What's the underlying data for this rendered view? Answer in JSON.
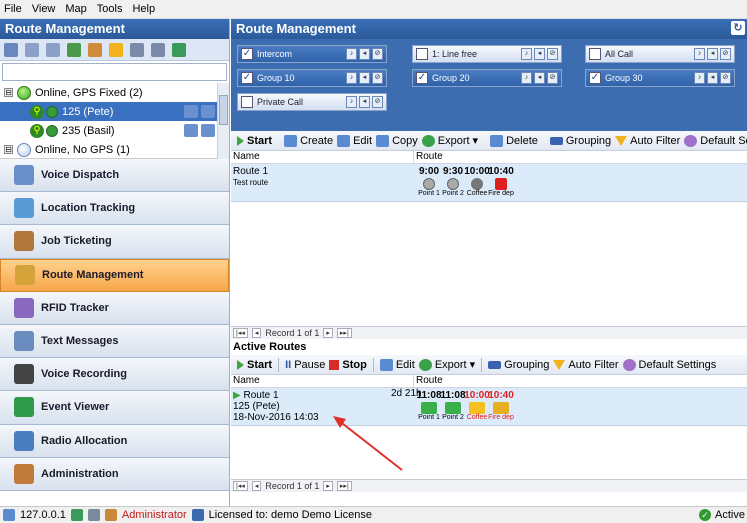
{
  "menu": [
    "File",
    "View",
    "Map",
    "Tools",
    "Help"
  ],
  "left_panel": {
    "title": "Route Management",
    "tree": [
      {
        "label": "Online, GPS Fixed (2)",
        "status": "green",
        "expand": "⊟"
      },
      {
        "label": "125 (Pete)",
        "selected": true
      },
      {
        "label": "235 (Basil)"
      },
      {
        "label": "Online, No GPS (1)",
        "status": "blue",
        "expand": "⊟"
      }
    ],
    "nav_items": [
      {
        "label": "Voice Dispatch",
        "icon": "voice-dispatch-icon",
        "color": "#6b8fc9"
      },
      {
        "label": "Location Tracking",
        "icon": "location-tracking-icon",
        "color": "#5a9bd5"
      },
      {
        "label": "Job Ticketing",
        "icon": "job-ticketing-icon",
        "color": "#b0783a"
      },
      {
        "label": "Route Management",
        "icon": "route-management-icon",
        "color": "#d4a43a",
        "active": true
      },
      {
        "label": "RFID Tracker",
        "icon": "rfid-tracker-icon",
        "color": "#8a6ac0"
      },
      {
        "label": "Text Messages",
        "icon": "text-messages-icon",
        "color": "#6a8cbf"
      },
      {
        "label": "Voice Recording",
        "icon": "voice-recording-icon",
        "color": "#444"
      },
      {
        "label": "Event Viewer",
        "icon": "event-viewer-icon",
        "color": "#2e9a4a"
      },
      {
        "label": "Radio Allocation",
        "icon": "radio-allocation-icon",
        "color": "#4a7cc0"
      },
      {
        "label": "Administration",
        "icon": "administration-icon",
        "color": "#c07a3a"
      }
    ]
  },
  "right_panel": {
    "title": "Route Management",
    "groups": [
      {
        "label": "Intercom",
        "checked": true
      },
      {
        "label": "1: Line free",
        "checked": false
      },
      {
        "label": "All Call",
        "checked": true
      },
      {
        "label": "Group 10",
        "checked": true
      },
      {
        "label": "Group 20",
        "checked": true
      },
      {
        "label": "Group 30",
        "checked": true
      },
      {
        "label": "Private Call",
        "checked": false
      }
    ],
    "routes_toolbar": {
      "start": "Start",
      "create": "Create",
      "edit": "Edit",
      "copy": "Copy",
      "export": "Export",
      "delete": "Delete",
      "grouping": "Grouping",
      "auto_filter": "Auto Filter",
      "default_settings": "Default Settings"
    },
    "grid_headers": {
      "name": "Name",
      "route": "Route"
    },
    "routes": [
      {
        "name": "Route 1",
        "description": "Test route",
        "points": [
          {
            "time": "9:00",
            "label": "Point 1",
            "icon": "point-icon"
          },
          {
            "time": "9:30",
            "label": "Point 2",
            "icon": "point-icon"
          },
          {
            "time": "10:00",
            "label": "Coffee",
            "icon": "coffee-icon"
          },
          {
            "time": "10:40",
            "label": "Fire dep",
            "icon": "fire-dep-icon"
          }
        ]
      }
    ],
    "pager_text": "Record 1 of 1",
    "active_title": "Active Routes",
    "active_toolbar": {
      "start": "Start",
      "pause": "Pause",
      "stop": "Stop",
      "edit": "Edit",
      "export": "Export",
      "grouping": "Grouping",
      "auto_filter": "Auto Filter",
      "default_settings": "Default Settings"
    },
    "active_routes": [
      {
        "name": "Route 1",
        "unit": "125 (Pete)",
        "date": "18-Nov-2016 14:03",
        "duration": "2d 21h",
        "points": [
          {
            "time": "11:08",
            "label": "Point 1",
            "late": false
          },
          {
            "time": "11:08",
            "label": "Point 2",
            "late": false
          },
          {
            "time": "10:00",
            "label": "Coffee",
            "late": true
          },
          {
            "time": "10:40",
            "label": "Fire dep",
            "late": true
          }
        ]
      }
    ]
  },
  "statusbar": {
    "ip": "127.0.0.1",
    "user": "Administrator",
    "license": "Licensed to: demo Demo License",
    "state": "Active"
  },
  "colors": {
    "accent": "#3a6fb5",
    "active_nav": "#f7a74a",
    "late": "#e02020"
  }
}
